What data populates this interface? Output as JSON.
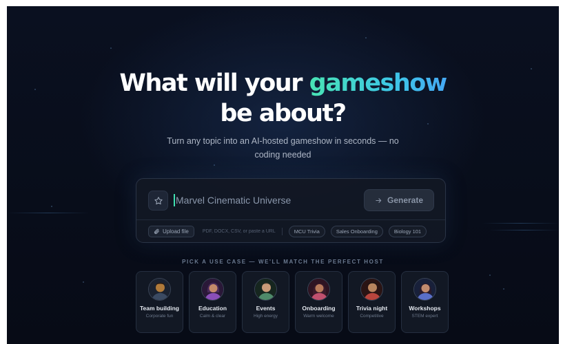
{
  "hero": {
    "title_before": "What will your",
    "title_accent": "gameshow",
    "title_after": "be about?",
    "subtitle": "Turn any topic into an AI-hosted gameshow in seconds — no coding needed"
  },
  "prompt": {
    "value": "Marvel Cinematic Universe",
    "star_icon": "star-icon",
    "generate_label": "Generate",
    "generate_icon": "arrow-right-icon",
    "upload_label": "Upload file",
    "upload_icon": "paperclip-icon",
    "upload_hint": "PDF, DOCX, CSV, or paste a URL",
    "suggestions": [
      "MCU Trivia",
      "Sales Onboarding",
      "Biology 101"
    ]
  },
  "use_cases": {
    "label": "PICK A USE CASE — WE'LL MATCH THE PERFECT HOST",
    "items": [
      {
        "title": "Team building",
        "subtitle": "Corporate fun",
        "avatar_color": "#b07a3a"
      },
      {
        "title": "Education",
        "subtitle": "Calm & clear",
        "avatar_color": "#8a4fb8"
      },
      {
        "title": "Events",
        "subtitle": "High energy",
        "avatar_color": "#4f8a6a"
      },
      {
        "title": "Onboarding",
        "subtitle": "Warm welcome",
        "avatar_color": "#c0506e"
      },
      {
        "title": "Trivia night",
        "subtitle": "Competitive",
        "avatar_color": "#b8453d"
      },
      {
        "title": "Workshops",
        "subtitle": "STEM expert",
        "avatar_color": "#5a6fc8"
      }
    ]
  },
  "colors": {
    "background": "#0a1020",
    "accent_green": "#49e3b4",
    "accent_blue": "#45a9f5"
  }
}
